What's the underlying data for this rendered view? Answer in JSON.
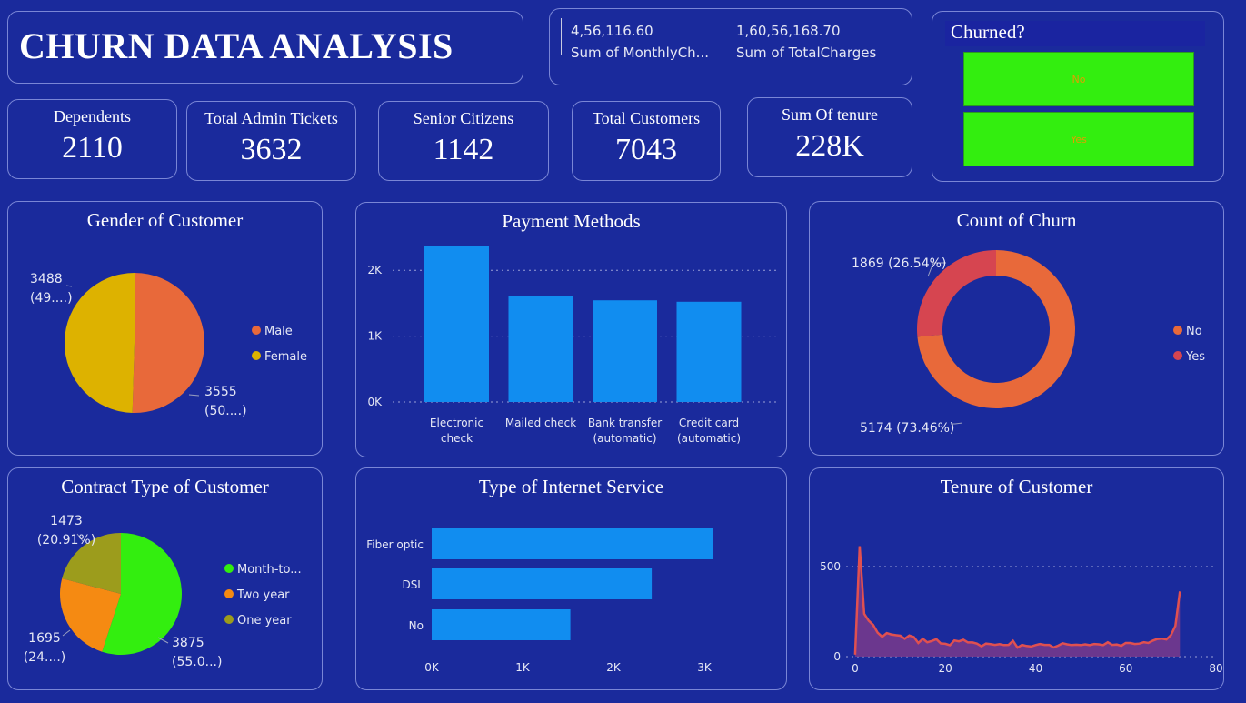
{
  "header": {
    "title": "CHURN DATA ANALYSIS"
  },
  "sums": {
    "monthly_value": "4,56,116.60",
    "monthly_label": "Sum of MonthlyCh...",
    "total_value": "1,60,56,168.70",
    "total_label": "Sum of TotalCharges"
  },
  "slicer": {
    "title": "Churned?",
    "options": [
      "No",
      "Yes"
    ]
  },
  "kpis": [
    {
      "label": "Dependents",
      "value": "2110"
    },
    {
      "label": "Total Admin Tickets",
      "value": "3632"
    },
    {
      "label": "Senior Citizens",
      "value": "1142"
    },
    {
      "label": "Total Customers",
      "value": "7043"
    },
    {
      "label": "Sum Of tenure",
      "value": "228K"
    }
  ],
  "chart_data": [
    {
      "id": "gender",
      "type": "pie",
      "title": "Gender of Customer",
      "categories": [
        "Male",
        "Female"
      ],
      "values": [
        3555,
        3488
      ],
      "colors": [
        "#e8693a",
        "#ddb200"
      ],
      "data_labels": [
        [
          "3555",
          "(50....)"
        ],
        [
          "3488",
          "(49....)"
        ]
      ],
      "legend": "right"
    },
    {
      "id": "payment",
      "type": "bar",
      "title": "Payment Methods",
      "categories": [
        [
          "Electronic",
          "check"
        ],
        [
          "Mailed check"
        ],
        [
          "Bank transfer",
          "(automatic)"
        ],
        [
          "Credit card",
          "(automatic)"
        ]
      ],
      "values": [
        2365,
        1612,
        1544,
        1522
      ],
      "ylim": [
        0,
        2500
      ],
      "yticks": [
        0,
        1000,
        2000
      ],
      "ytick_labels": [
        "0K",
        "1K",
        "2K"
      ],
      "color": "#118df0",
      "grid": true
    },
    {
      "id": "churn",
      "type": "pie",
      "title": "Count of Churn",
      "categories": [
        "No",
        "Yes"
      ],
      "values": [
        5174,
        1869
      ],
      "colors": [
        "#e8693a",
        "#d64550"
      ],
      "data_labels": [
        "5174 (73.46%)",
        "1869 (26.54%)"
      ],
      "legend": "right"
    },
    {
      "id": "contract",
      "type": "pie",
      "title": "Contract Type of Customer",
      "categories": [
        "Month-to...",
        "Two year",
        "One year"
      ],
      "values": [
        3875,
        1695,
        1473
      ],
      "colors": [
        "#33ee0f",
        "#f58a12",
        "#9c9c1c"
      ],
      "data_labels": [
        [
          "3875",
          "(55.0...)"
        ],
        [
          "1695",
          "(24....)"
        ],
        [
          "1473",
          "(20.91%)"
        ]
      ],
      "legend": "right"
    },
    {
      "id": "internet",
      "type": "bar",
      "orientation": "horizontal",
      "title": "Type of Internet Service",
      "categories": [
        "Fiber optic",
        "DSL",
        "No"
      ],
      "values": [
        3096,
        2421,
        1526
      ],
      "xlim": [
        0,
        3200
      ],
      "xticks": [
        0,
        1000,
        2000,
        3000
      ],
      "xtick_labels": [
        "0K",
        "1K",
        "2K",
        "3K"
      ],
      "color": "#118df0"
    },
    {
      "id": "tenure",
      "type": "area",
      "title": "Tenure of Customer",
      "x": [
        0,
        1,
        2,
        3,
        4,
        5,
        6,
        7,
        8,
        9,
        10,
        11,
        12,
        13,
        14,
        15,
        16,
        17,
        18,
        19,
        20,
        21,
        22,
        23,
        24,
        25,
        26,
        27,
        28,
        29,
        30,
        31,
        32,
        33,
        34,
        35,
        36,
        37,
        38,
        39,
        40,
        41,
        42,
        43,
        44,
        45,
        46,
        47,
        48,
        49,
        50,
        51,
        52,
        53,
        54,
        55,
        56,
        57,
        58,
        59,
        60,
        61,
        62,
        63,
        64,
        65,
        66,
        67,
        68,
        69,
        70,
        71,
        72
      ],
      "y": [
        11,
        613,
        238,
        200,
        176,
        133,
        110,
        131,
        123,
        119,
        116,
        99,
        117,
        109,
        76,
        99,
        80,
        87,
        97,
        73,
        71,
        63,
        90,
        85,
        94,
        79,
        79,
        72,
        57,
        72,
        69,
        65,
        69,
        64,
        65,
        88,
        50,
        65,
        59,
        56,
        64,
        70,
        65,
        65,
        51,
        61,
        74,
        68,
        64,
        66,
        64,
        68,
        64,
        70,
        68,
        64,
        80,
        65,
        67,
        60,
        76,
        76,
        70,
        72,
        80,
        76,
        89,
        98,
        100,
        95,
        119,
        170,
        362
      ],
      "xlim": [
        -2,
        80
      ],
      "ylim": [
        0,
        650
      ],
      "xticks": [
        0,
        20,
        40,
        60,
        80
      ],
      "yticks": [
        0,
        500
      ],
      "line_color": "#e05050",
      "fill_color": "#7a3a8c",
      "grid": true
    }
  ]
}
